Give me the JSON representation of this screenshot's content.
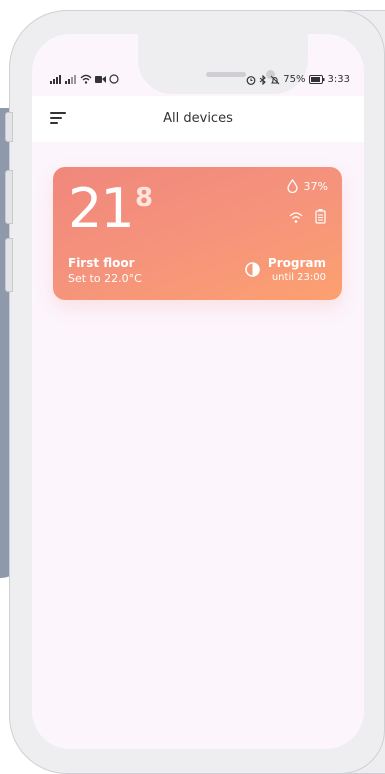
{
  "status_bar": {
    "battery_percent": "75%",
    "time": "3:33"
  },
  "header": {
    "title": "All devices",
    "menu_icon": "hamburger-menu-icon"
  },
  "devices": [
    {
      "temperature_whole": "21",
      "temperature_decimal": "8",
      "humidity": "37%",
      "name": "First floor",
      "setpoint": "Set to 22.0°C",
      "mode": "Program",
      "mode_until": "until 23:00",
      "icons": [
        "water-drop-icon",
        "wifi-icon",
        "battery-icon",
        "half-circle-mode-icon"
      ]
    }
  ],
  "colors": {
    "card_gradient_start": "#f0877c",
    "card_gradient_end": "#fca070",
    "screen_background": "#fcf5fc"
  }
}
